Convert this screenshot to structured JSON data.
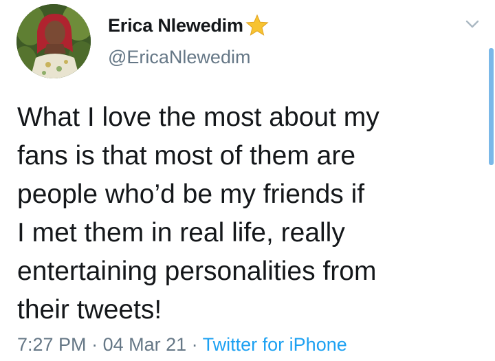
{
  "author": {
    "display_name": "Erica Nlewedim",
    "handle": "@EricaNlewedim",
    "badge_icon": "star-icon",
    "badge_color": "#f7c331"
  },
  "tweet": {
    "text": "What I love the most about my\nfans is that most of them are\npeople who’d be my friends if\nI met them in real life, really\nentertaining personalities from\ntheir tweets!",
    "time": "7:27 PM",
    "separator": " · ",
    "date": "04 Mar 21",
    "source": "Twitter for iPhone"
  },
  "icons": {
    "caret": "chevron-down-icon",
    "avatar": "avatar"
  },
  "colors": {
    "text": "#14171a",
    "secondary": "#657786",
    "link": "#1da1f2"
  }
}
